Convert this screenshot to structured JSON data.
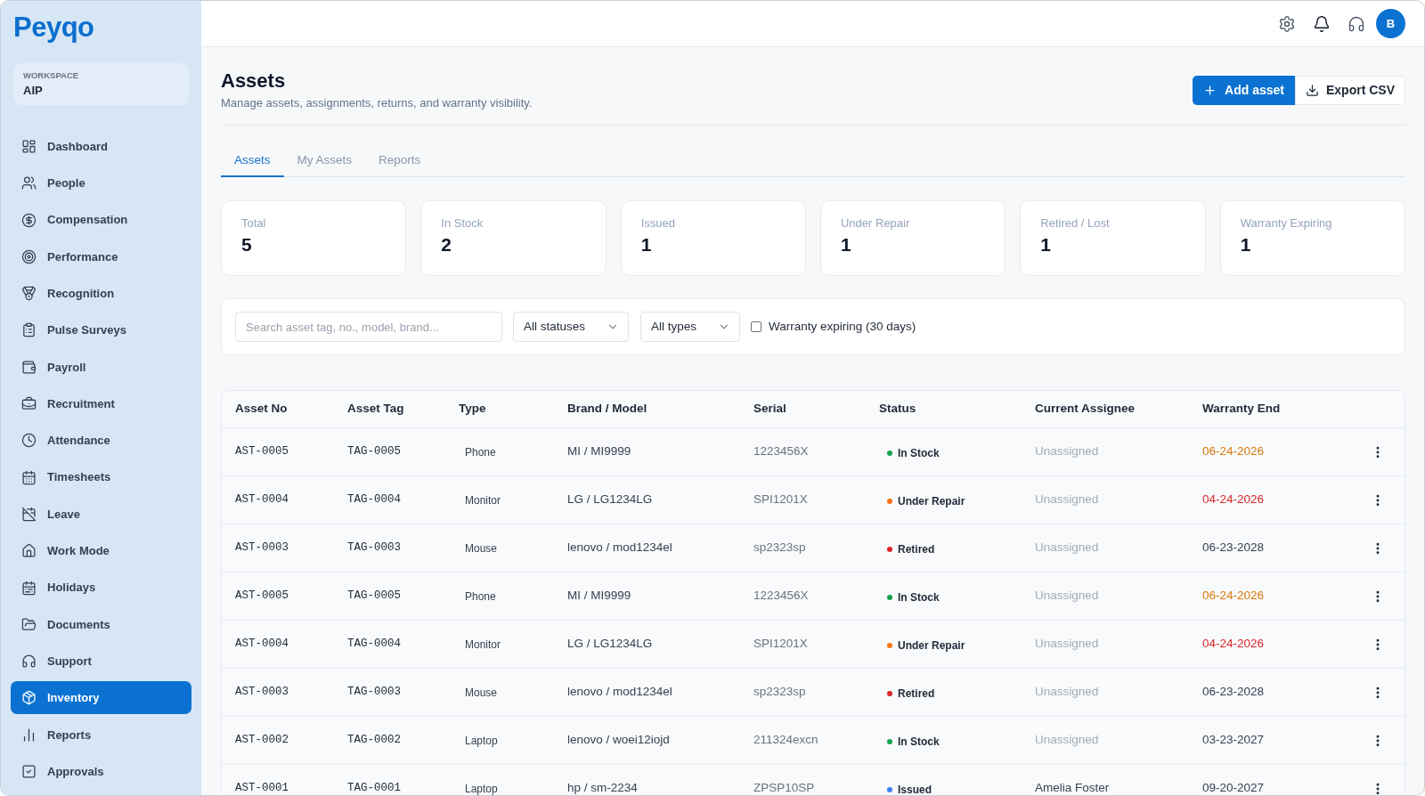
{
  "sidebar": {
    "logo": "Peyqo",
    "workspace": {
      "label": "WORKSPACE",
      "name": "AIP"
    },
    "items": [
      {
        "label": "Dashboard",
        "selected": false
      },
      {
        "label": "People",
        "selected": false
      },
      {
        "label": "Compensation",
        "selected": false
      },
      {
        "label": "Performance",
        "selected": false
      },
      {
        "label": "Recognition",
        "selected": false
      },
      {
        "label": "Pulse Surveys",
        "selected": false
      },
      {
        "label": "Payroll",
        "selected": false
      },
      {
        "label": "Recruitment",
        "selected": false
      },
      {
        "label": "Attendance",
        "selected": false
      },
      {
        "label": "Timesheets",
        "selected": false
      },
      {
        "label": "Leave",
        "selected": false
      },
      {
        "label": "Work Mode",
        "selected": false
      },
      {
        "label": "Holidays",
        "selected": false
      },
      {
        "label": "Documents",
        "selected": false
      },
      {
        "label": "Support",
        "selected": false
      },
      {
        "label": "Inventory",
        "selected": true
      },
      {
        "label": "Reports",
        "selected": false
      },
      {
        "label": "Approvals",
        "selected": false
      }
    ]
  },
  "header": {
    "avatar": "B"
  },
  "page": {
    "title": "Assets",
    "subtitle": "Manage assets, assignments, returns, and warranty visibility.",
    "actions": [
      {
        "label": "Add asset",
        "kind": "primary"
      },
      {
        "label": "Export CSV",
        "kind": "secondary"
      }
    ]
  },
  "tabs": [
    {
      "label": "Assets",
      "selected": true
    },
    {
      "label": "My Assets",
      "selected": false
    },
    {
      "label": "Reports",
      "selected": false
    }
  ],
  "stats": [
    {
      "label": "Total",
      "value": "5"
    },
    {
      "label": "In Stock",
      "value": "2"
    },
    {
      "label": "Issued",
      "value": "1"
    },
    {
      "label": "Under Repair",
      "value": "1"
    },
    {
      "label": "Retired / Lost",
      "value": "1"
    },
    {
      "label": "Warranty Expiring",
      "value": "1"
    }
  ],
  "filters": {
    "search": {
      "placeholder": "Search asset tag, no., model, brand..."
    },
    "dropdowns": [
      {
        "value": "All statuses"
      },
      {
        "value": "All types"
      }
    ],
    "checkbox": {
      "label": "Warranty expiring (30 days)",
      "checked": false
    }
  },
  "table": {
    "columns": [
      "Asset No",
      "Asset Tag",
      "Type",
      "Brand / Model",
      "Serial",
      "Status",
      "Current Assignee",
      "Warranty End"
    ],
    "rows": [
      {
        "asset_no": "AST-0005",
        "asset_tag": "TAG-0005",
        "type": "Phone",
        "brand_model": "MI / MI9999",
        "serial": "1223456X",
        "status": {
          "label": "In Stock",
          "color": "#16a34a"
        },
        "assignee": {
          "text": "Unassigned",
          "assigned": false
        },
        "warranty_end": {
          "text": "06-24-2026",
          "color": "#d97706"
        }
      },
      {
        "asset_no": "AST-0004",
        "asset_tag": "TAG-0004",
        "type": "Monitor",
        "brand_model": "LG / LG1234LG",
        "serial": "SPI1201X",
        "status": {
          "label": "Under Repair",
          "color": "#f97316"
        },
        "assignee": {
          "text": "Unassigned",
          "assigned": false
        },
        "warranty_end": {
          "text": "04-24-2026",
          "color": "#dc2626"
        }
      },
      {
        "asset_no": "AST-0003",
        "asset_tag": "TAG-0003",
        "type": "Mouse",
        "brand_model": "lenovo / mod1234el",
        "serial": "sp2323sp",
        "status": {
          "label": "Retired",
          "color": "#dc2626"
        },
        "assignee": {
          "text": "Unassigned",
          "assigned": false
        },
        "warranty_end": {
          "text": "06-23-2028",
          "color": "#374151"
        }
      },
      {
        "asset_no": "AST-0005",
        "asset_tag": "TAG-0005",
        "type": "Phone",
        "brand_model": "MI / MI9999",
        "serial": "1223456X",
        "status": {
          "label": "In Stock",
          "color": "#16a34a"
        },
        "assignee": {
          "text": "Unassigned",
          "assigned": false
        },
        "warranty_end": {
          "text": "06-24-2026",
          "color": "#d97706"
        }
      },
      {
        "asset_no": "AST-0004",
        "asset_tag": "TAG-0004",
        "type": "Monitor",
        "brand_model": "LG / LG1234LG",
        "serial": "SPI1201X",
        "status": {
          "label": "Under Repair",
          "color": "#f97316"
        },
        "assignee": {
          "text": "Unassigned",
          "assigned": false
        },
        "warranty_end": {
          "text": "04-24-2026",
          "color": "#dc2626"
        }
      },
      {
        "asset_no": "AST-0003",
        "asset_tag": "TAG-0003",
        "type": "Mouse",
        "brand_model": "lenovo / mod1234el",
        "serial": "sp2323sp",
        "status": {
          "label": "Retired",
          "color": "#dc2626"
        },
        "assignee": {
          "text": "Unassigned",
          "assigned": false
        },
        "warranty_end": {
          "text": "06-23-2028",
          "color": "#374151"
        }
      },
      {
        "asset_no": "AST-0002",
        "asset_tag": "TAG-0002",
        "type": "Laptop",
        "brand_model": "lenovo / woei12iojd",
        "serial": "211324excn",
        "status": {
          "label": "In Stock",
          "color": "#16a34a"
        },
        "assignee": {
          "text": "Unassigned",
          "assigned": false
        },
        "warranty_end": {
          "text": "03-23-2027",
          "color": "#374151"
        }
      },
      {
        "asset_no": "AST-0001",
        "asset_tag": "TAG-0001",
        "type": "Laptop",
        "brand_model": "hp / sm-2234",
        "serial": "ZPSP10SP",
        "status": {
          "label": "Issued",
          "color": "#3b82f6"
        },
        "assignee": {
          "text": "Amelia Foster",
          "assigned": true
        },
        "warranty_end": {
          "text": "09-20-2027",
          "color": "#374151"
        }
      }
    ]
  }
}
